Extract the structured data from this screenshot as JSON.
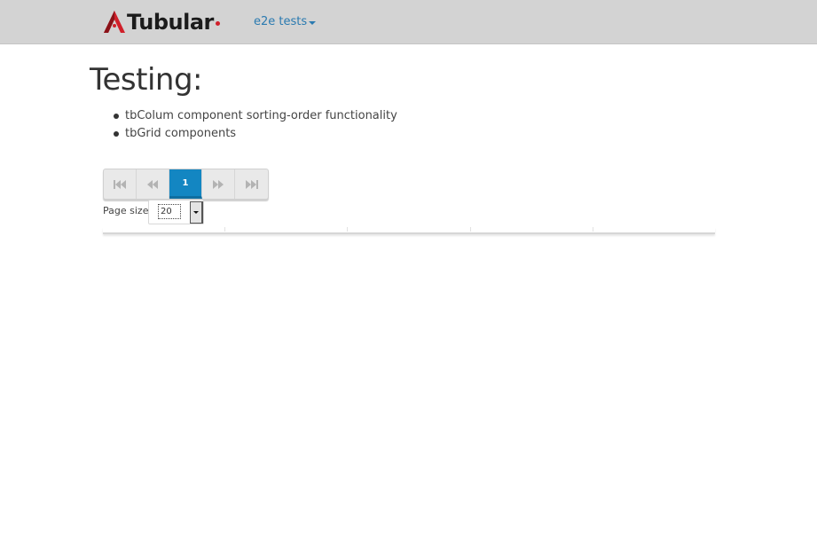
{
  "header": {
    "brand": "Tubular",
    "menu_label": "e2e tests"
  },
  "main": {
    "title": "Testing:",
    "features": [
      "tbColum component sorting-order functionality",
      "tbGrid components"
    ]
  },
  "pager": {
    "current_page": "1",
    "buttons": [
      "first-page",
      "previous-page",
      "1",
      "next-page",
      "last-page"
    ]
  },
  "page_size": {
    "label": "Page size:",
    "value": "20"
  },
  "grid": {
    "column_count": 5
  },
  "colors": {
    "navbar": "#d3d3d3",
    "link": "#2a7ab0",
    "active_page": "#1386c2",
    "brand_red": "#d0202a"
  }
}
